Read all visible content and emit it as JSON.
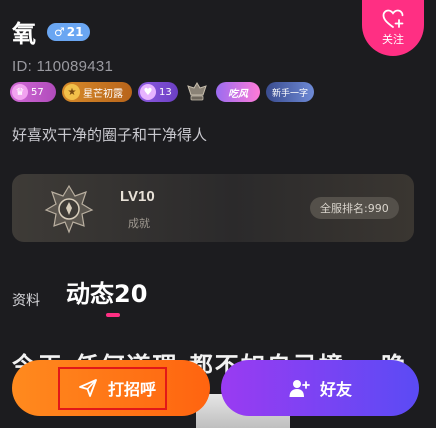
{
  "profile": {
    "name": "氧",
    "gender_badge": {
      "symbol": "♂",
      "age": "21"
    },
    "uid": "ID: 110089431",
    "bio": "好喜欢干净的圈子和干净得人"
  },
  "follow_button": {
    "label": "关注"
  },
  "badges": [
    {
      "icon": "level-badge-icon",
      "text": "57"
    },
    {
      "icon": "star-badge-icon",
      "text": "星芒初露"
    },
    {
      "icon": "heart-badge-icon",
      "text": "13"
    },
    {
      "icon": "crown-badge-icon",
      "text": ""
    },
    {
      "icon": "chi-badge-icon",
      "text": "吃风"
    },
    {
      "icon": "newcomer-badge-icon",
      "text": "新手一字"
    }
  ],
  "achievement": {
    "level": "LV10",
    "subtitle": "成就",
    "rank_label": "全服排名:990"
  },
  "tabs": {
    "info": "资料",
    "posts": "动态20"
  },
  "post_preview_text": "今天 任何道理 都不如自己撞 一晚",
  "actions": {
    "greet": "打招呼",
    "friend": "好友"
  },
  "colors": {
    "accent_pink": "#ff2f83",
    "greet_orange": "#ff7a16",
    "friend_purple": "#7a43f3",
    "highlight_red": "#e21818"
  }
}
